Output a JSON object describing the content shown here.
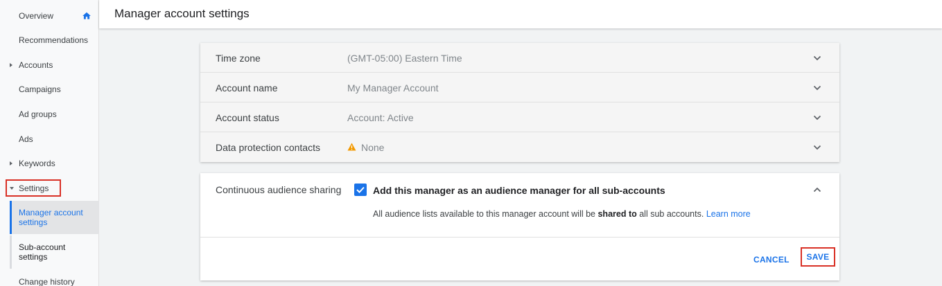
{
  "sidebar": {
    "items": [
      {
        "label": "Overview"
      },
      {
        "label": "Recommendations"
      },
      {
        "label": "Accounts"
      },
      {
        "label": "Campaigns"
      },
      {
        "label": "Ad groups"
      },
      {
        "label": "Ads"
      },
      {
        "label": "Keywords"
      },
      {
        "label": "Settings"
      }
    ],
    "settings_sub": [
      {
        "label_line1": "Manager account",
        "label_line2": "settings"
      },
      {
        "label_line1": "Sub-account",
        "label_line2": "settings"
      }
    ],
    "change_history": "Change history"
  },
  "header": {
    "title": "Manager account settings"
  },
  "settings": {
    "rows": [
      {
        "label": "Time zone",
        "value": "(GMT-05:00) Eastern Time"
      },
      {
        "label": "Account name",
        "value": "My Manager Account"
      },
      {
        "label": "Account status",
        "value": "Account: Active"
      },
      {
        "label": "Data protection contacts",
        "value": "None"
      }
    ],
    "audience": {
      "label": "Continuous audience sharing",
      "checkbox_label": "Add this manager as an audience manager for all sub-accounts",
      "desc_pre": "All audience lists available to this manager account will be ",
      "desc_bold": "shared to",
      "desc_post": " all sub accounts. ",
      "learn_more": "Learn more"
    },
    "buttons": {
      "cancel": "CANCEL",
      "save": "SAVE"
    }
  },
  "colors": {
    "accent": "#1a73e8",
    "highlight": "#d93025",
    "warning": "#f29900"
  }
}
